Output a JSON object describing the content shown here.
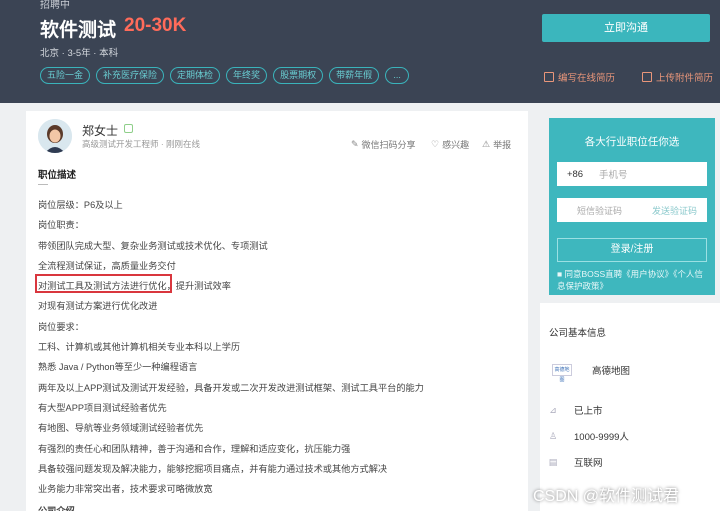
{
  "header": {
    "status_top": "招聘中",
    "job_title": "软件测试",
    "salary": "20-30K",
    "meta": "北京 · 3-5年 · 本科",
    "tags": [
      "五险一金",
      "补充医疗保险",
      "定期体检",
      "年终奖",
      "股票期权",
      "带薪年假",
      "..."
    ],
    "apply_label": "立即沟通",
    "online_resume_label": "编写在线简历",
    "upload_resume_label": "上传附件简历"
  },
  "recruiter": {
    "name": "郑女士",
    "title": "高级测试开发工程师 · 刚刚在线",
    "actions": {
      "share": "微信扫码分享",
      "favorite": "感兴趣",
      "report": "举报"
    }
  },
  "description": {
    "title": "职位描述",
    "lines": [
      "岗位层级：P6及以上",
      "岗位职责：",
      "带领团队完成大型、复杂业务测试或技术优化、专项测试",
      "全流程测试保证，高质量业务交付",
      "对测试工具及测试方法进行优化，提升测试效率",
      "对现有测试方案进行优化改进",
      "岗位要求：",
      "工科、计算机或其他计算机相关专业本科以上学历",
      "熟悉 Java / Python等至少一种编程语言",
      "两年及以上APP测试及测试开发经验，具备开发或二次开发改进测试框架、测试工具平台的能力",
      "有大型APP项目测试经验者优先",
      "有地图、导航等业务领域测试经验者优先",
      "有强烈的责任心和团队精神，善于沟通和合作，理解和适应变化，抗压能力强",
      "具备较强问题发现及解决能力，能够挖掘项目痛点，并有能力通过技术或其他方式解决",
      "业务能力非常突出者，技术要求可略微放宽",
      "公司介绍"
    ]
  },
  "login": {
    "title": "各大行业职位任你选",
    "phone_code": "+86",
    "phone_placeholder": "手机号",
    "code_placeholder": "短信验证码",
    "send_code": "发送验证码",
    "button": "登录/注册",
    "agreement": "■ 同意BOSS直聘《用户协议》《个人信息保护政策》"
  },
  "company": {
    "section_title": "公司基本信息",
    "logo_text": "高德地图",
    "name": "高德地图",
    "stage": "已上市",
    "size": "1000-9999人",
    "industry": "互联网"
  },
  "watermark": "CSDN @软件测试君",
  "colors": {
    "header_bg": "#3b4454",
    "accent": "#3bb6bd",
    "salary": "#ff6b5a",
    "highlight": "#d9363e"
  }
}
